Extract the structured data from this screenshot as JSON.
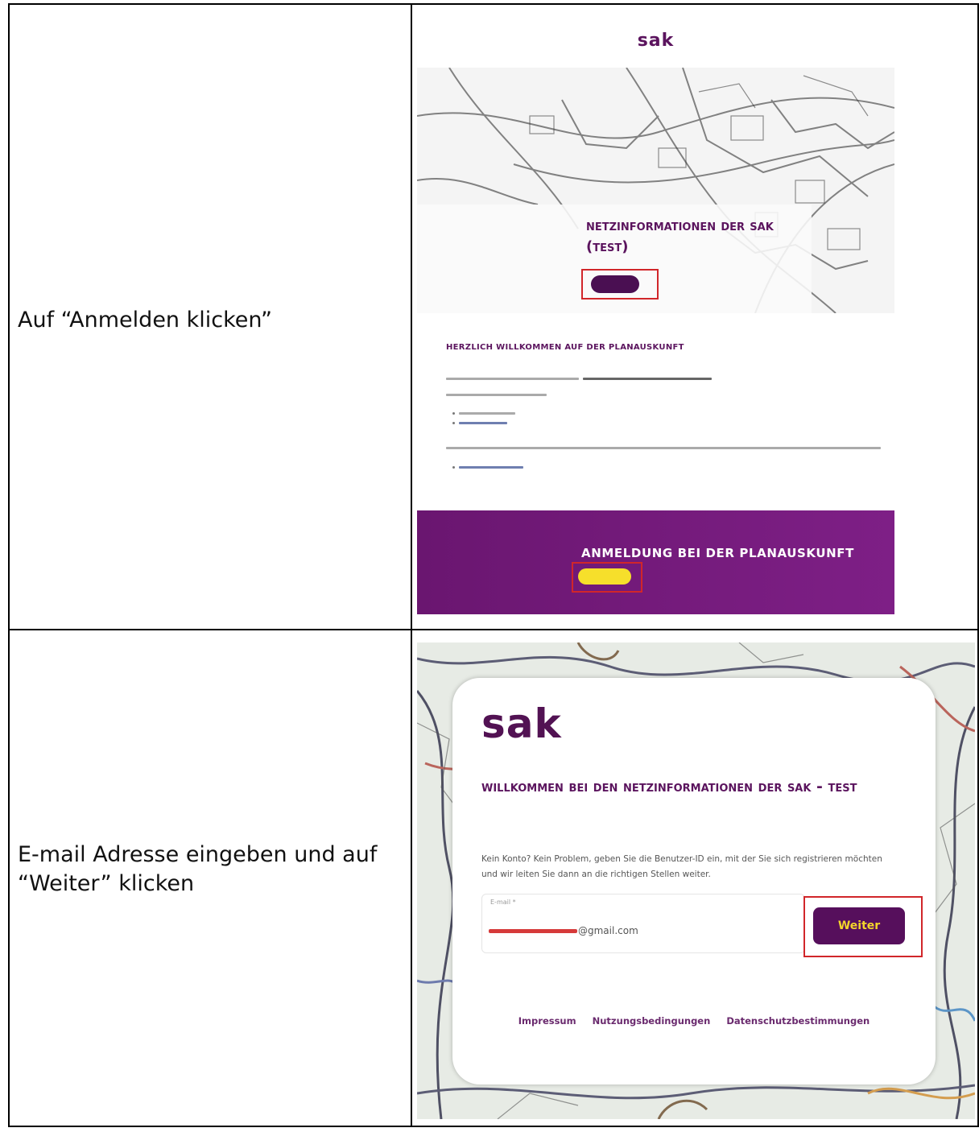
{
  "steps": [
    {
      "instruction": "Auf “Anmelden klicken”"
    },
    {
      "instruction": "E-mail Adresse eingeben und auf “Weiter” klicken"
    }
  ],
  "screenshot1": {
    "brand": "sak",
    "hero_title": "Netzinformationen der SAK (TEST)",
    "welcome_heading": "Herzlich willkommen auf der Planauskunft",
    "footer_title": "Anmeldung bei der Planauskunft"
  },
  "screenshot2": {
    "brand": "sak",
    "title": "Willkommen bei den Netzinformationen der SAK - TEST",
    "description": "Kein Konto? Kein Problem, geben Sie die Benutzer-ID ein, mit der Sie sich registrieren möchten und wir leiten Sie dann an die richtigen Stellen weiter.",
    "email_label": "E-mail *",
    "email_value": "@gmail.com",
    "submit_label": "Weiter",
    "footer_links": [
      "Impressum",
      "Nutzungsbedingungen",
      "Datenschutzbestimmungen"
    ]
  },
  "colors": {
    "brand_purple": "#5b145e",
    "highlight_red": "#d1262a",
    "button_yellow": "#f6df2b"
  }
}
